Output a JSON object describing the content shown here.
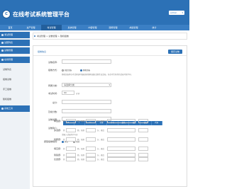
{
  "header": {
    "logo_text": "C",
    "title": "在线考试系统管理平台",
    "user_label": "admin",
    "caret": "▾"
  },
  "topnav": [
    "首页",
    "资产管理",
    "考试管理",
    "系统管理",
    "内容管理",
    "题库管理",
    "成绩管理",
    "统计"
  ],
  "sidebar": {
    "items": [
      "考试管理",
      "试题列表",
      "试卷管理",
      "在线管理"
    ],
    "subs": [
      "试卷列表",
      "组卷试卷",
      "手工组卷",
      "随机组卷"
    ],
    "last": "系统工具"
  },
  "breadcrumb": "考试管理 > 试卷管理 > 随机组卷",
  "panel": {
    "title": "组卷信息",
    "save_label": "保存试卷"
  },
  "form": {
    "name_label": "试卷名称:",
    "type_label": "组卷方式:",
    "type_options": [
      "固定试卷",
      "随机组卷"
    ],
    "type_hint": "随机组卷将在考试开始时根据规则随机抽取试题生成试卷，每位考生获得的试卷可能不同。",
    "category_label": "所属分类:",
    "category_value": "请选择分类",
    "time_label": "考试时间:",
    "time_value": "60",
    "time_unit": "分钟",
    "total_label": "总分:",
    "pass_label": "及格分数:",
    "desc_label": "试卷说明:",
    "intro_label": "试卷简介:",
    "toolbar": [
      "B",
      "I",
      "U",
      "字体",
      "字号",
      "颜色",
      "图片",
      "链接",
      "代码"
    ],
    "toolbar_hint": "请输入试卷简介内容",
    "rules_label": "题型组卷规则:",
    "rules_options": [
      "开启",
      "关闭"
    ]
  },
  "rules": [
    {
      "label": "单选题:",
      "c1": "共",
      "c2": "题，每题",
      "c3": "分，难度"
    },
    {
      "label": "多选题:",
      "c1": "共",
      "c2": "题，每题",
      "c3": "分，难度"
    },
    {
      "label": "判断题:",
      "c1": "共",
      "c2": "题，每题",
      "c3": "分，难度"
    },
    {
      "label": "填空题:",
      "c1": "共",
      "c2": "题，每题",
      "c3": "分，难度"
    },
    {
      "label": "简答题:",
      "c1": "共",
      "c2": "题，每题",
      "c3": "分，难度"
    },
    {
      "label": "论述题:",
      "c1": "共",
      "c2": "题，每题",
      "c3": "分，难度"
    }
  ]
}
